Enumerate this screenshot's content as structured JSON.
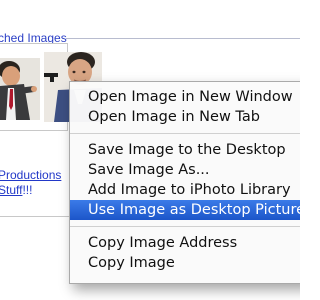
{
  "fieldset": {
    "legend": "ched Images"
  },
  "footer_links": {
    "line1_link": "Productions",
    "line2_link": "Stuff",
    "line2_suffix": "!!!"
  },
  "context_menu": {
    "groups": [
      [
        {
          "label": "Open Image in New Window"
        },
        {
          "label": "Open Image in New Tab"
        }
      ],
      [
        {
          "label": "Save Image to the Desktop"
        },
        {
          "label": "Save Image As..."
        },
        {
          "label": "Add Image to iPhoto Library"
        },
        {
          "label": "Use Image as Desktop Picture",
          "highlighted": true
        }
      ],
      [
        {
          "label": "Copy Image Address"
        },
        {
          "label": "Copy Image"
        }
      ]
    ]
  },
  "colors": {
    "link": "#2238c8",
    "menu_highlight": "#1f5fd6"
  }
}
